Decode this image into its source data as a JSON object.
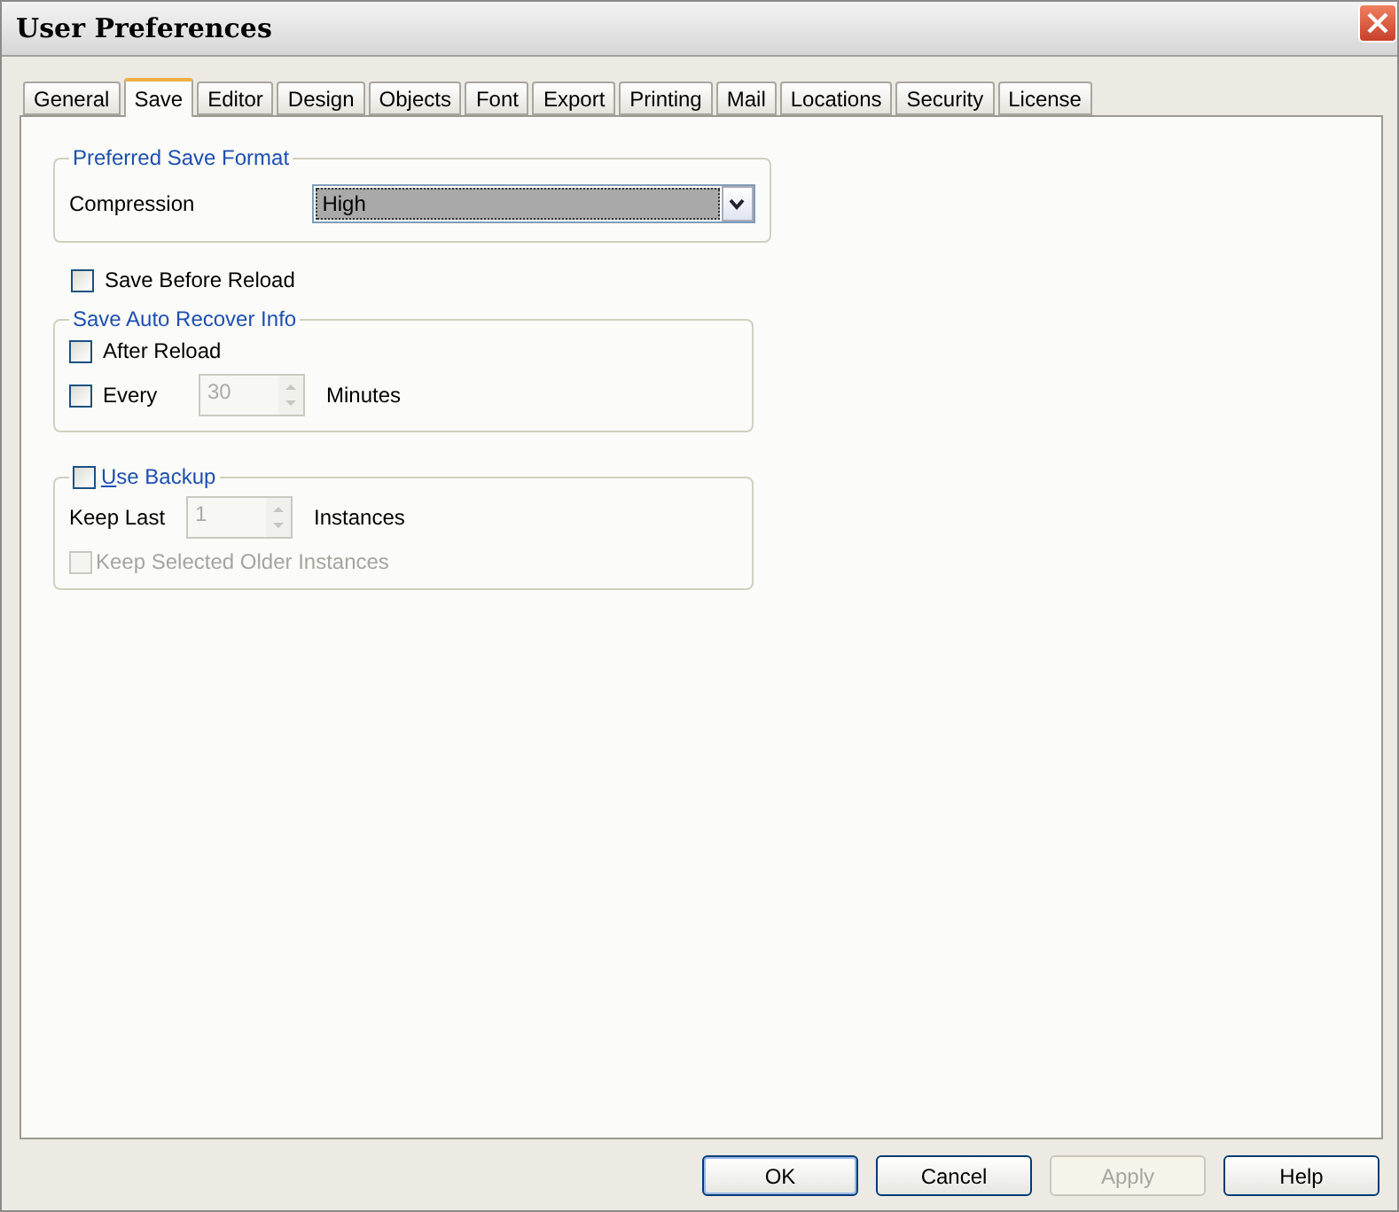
{
  "window": {
    "title": "User Preferences"
  },
  "tabs": [
    {
      "label": "General",
      "selected": false
    },
    {
      "label": "Save",
      "selected": true
    },
    {
      "label": "Editor",
      "selected": false
    },
    {
      "label": "Design",
      "selected": false
    },
    {
      "label": "Objects",
      "selected": false
    },
    {
      "label": "Font",
      "selected": false
    },
    {
      "label": "Export",
      "selected": false
    },
    {
      "label": "Printing",
      "selected": false
    },
    {
      "label": "Mail",
      "selected": false
    },
    {
      "label": "Locations",
      "selected": false
    },
    {
      "label": "Security",
      "selected": false
    },
    {
      "label": "License",
      "selected": false
    }
  ],
  "format_group": {
    "title": "Preferred Save Format",
    "label": "Compression",
    "value": "High"
  },
  "save_before_reload": {
    "label": "Save Before Reload",
    "checked": false
  },
  "auto_recover": {
    "title": "Save Auto Recover Info",
    "after_reload": {
      "label": "After Reload",
      "checked": false
    },
    "every": {
      "label": "Every",
      "checked": false,
      "value": "30",
      "disabled": true,
      "unit": "Minutes"
    }
  },
  "backup": {
    "title": "Use Backup",
    "checked": false,
    "keep_last": {
      "label": "Keep Last",
      "value": "1",
      "disabled": true,
      "unit": "Instances"
    },
    "keep_selected": {
      "label": "Keep Selected Older Instances",
      "checked": false,
      "disabled": true
    }
  },
  "buttons": [
    {
      "label": "OK",
      "disabled": false,
      "default": true
    },
    {
      "label": "Cancel",
      "disabled": false,
      "default": false
    },
    {
      "label": "Apply",
      "disabled": true,
      "default": false
    },
    {
      "label": "Help",
      "disabled": false,
      "default": false
    }
  ]
}
